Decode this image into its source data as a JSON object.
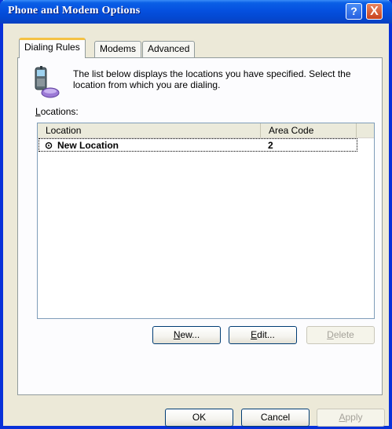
{
  "window": {
    "title": "Phone and Modem Options",
    "help_glyph": "?",
    "close_glyph": "X"
  },
  "tabs": [
    {
      "label": "Dialing Rules",
      "active": true
    },
    {
      "label": "Modems",
      "active": false
    },
    {
      "label": "Advanced",
      "active": false
    }
  ],
  "dialing": {
    "description": "The list below displays the locations you have specified. Select the location from which you are dialing.",
    "locations_label": {
      "accel": "L",
      "rest": "ocations:"
    },
    "columns": {
      "location": "Location",
      "area_code": "Area Code"
    },
    "rows": [
      {
        "icon_glyph": "⊙",
        "name": "New Location",
        "area_code": "2",
        "selected": true
      }
    ],
    "buttons": {
      "new": {
        "accel": "N",
        "rest": "ew..."
      },
      "edit": {
        "accel": "E",
        "rest": "dit..."
      },
      "delete": {
        "accel": "D",
        "rest": "elete",
        "disabled": true
      }
    }
  },
  "footer": {
    "ok": "OK",
    "cancel": "Cancel",
    "apply": {
      "accel": "A",
      "rest": "pply",
      "disabled": true
    }
  },
  "colors": {
    "titlebar": "#0550df",
    "window_border": "#0831d9",
    "dialog_face": "#ece9d8",
    "tab_highlight": "#f5c243"
  },
  "icons": {
    "phone": "cell-phone-icon",
    "location_row": "location-radio-icon"
  }
}
